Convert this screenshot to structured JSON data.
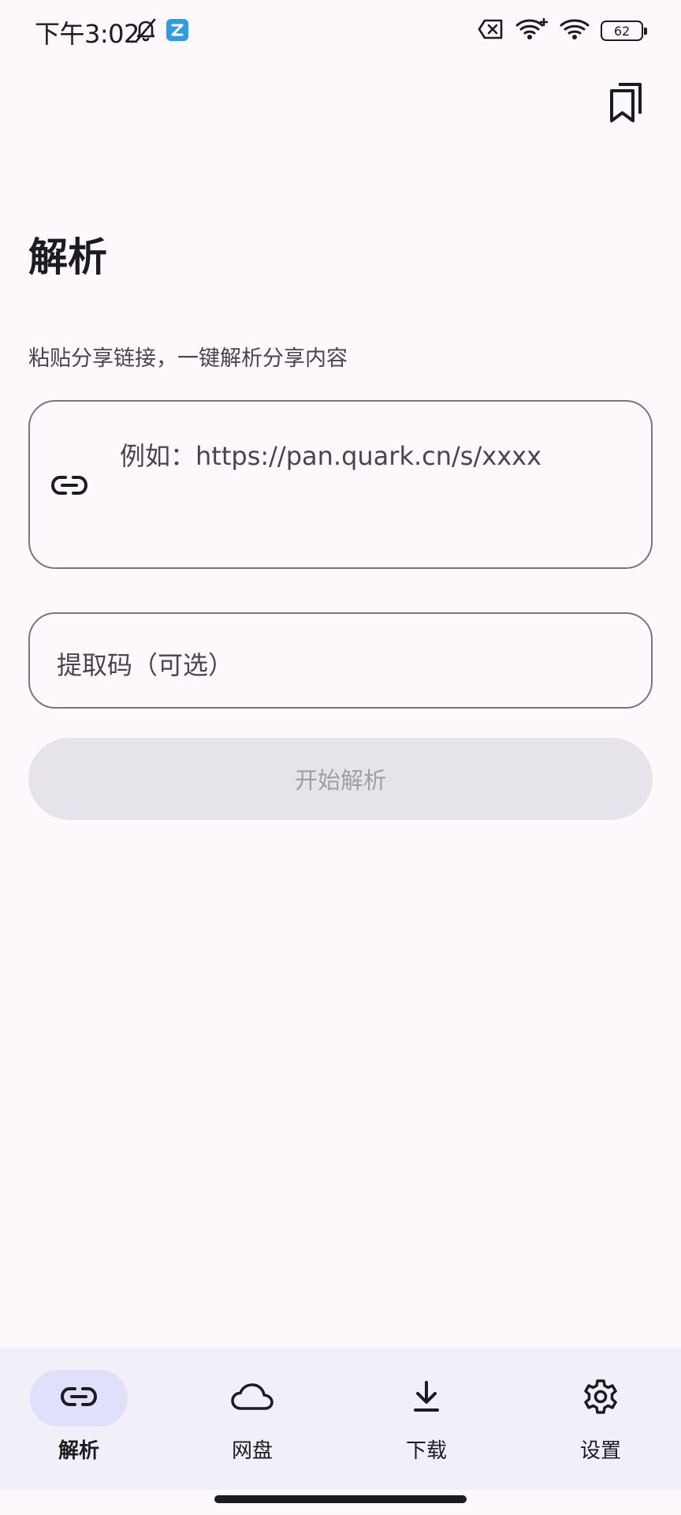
{
  "status_bar": {
    "time": "下午3:02",
    "battery_level": "62",
    "icons": [
      "bell-off-icon",
      "app-notification-icon",
      "sim-off-icon",
      "wifi-plus-icon",
      "wifi-icon",
      "battery-icon"
    ]
  },
  "header": {
    "bookmark_icon": "bookmarks-icon",
    "title": "解析",
    "subtitle": "粘贴分享链接，一键解析分享内容"
  },
  "form": {
    "link_placeholder": "例如：https://pan.quark.cn/s/xxxx",
    "link_icon": "link-icon",
    "code_placeholder": "提取码（可选）",
    "submit_label": "开始解析"
  },
  "bottom_nav": {
    "items": [
      {
        "label": "解析",
        "icon": "link-icon",
        "active": true
      },
      {
        "label": "网盘",
        "icon": "cloud-icon",
        "active": false
      },
      {
        "label": "下载",
        "icon": "download-icon",
        "active": false
      },
      {
        "label": "设置",
        "icon": "gear-icon",
        "active": false
      }
    ]
  },
  "colors": {
    "background": "#fdf8fc",
    "nav_background": "#f1eff8",
    "active_indicator": "#e0e0fb",
    "button_disabled": "#e6e3ea",
    "outline": "#79747e"
  }
}
